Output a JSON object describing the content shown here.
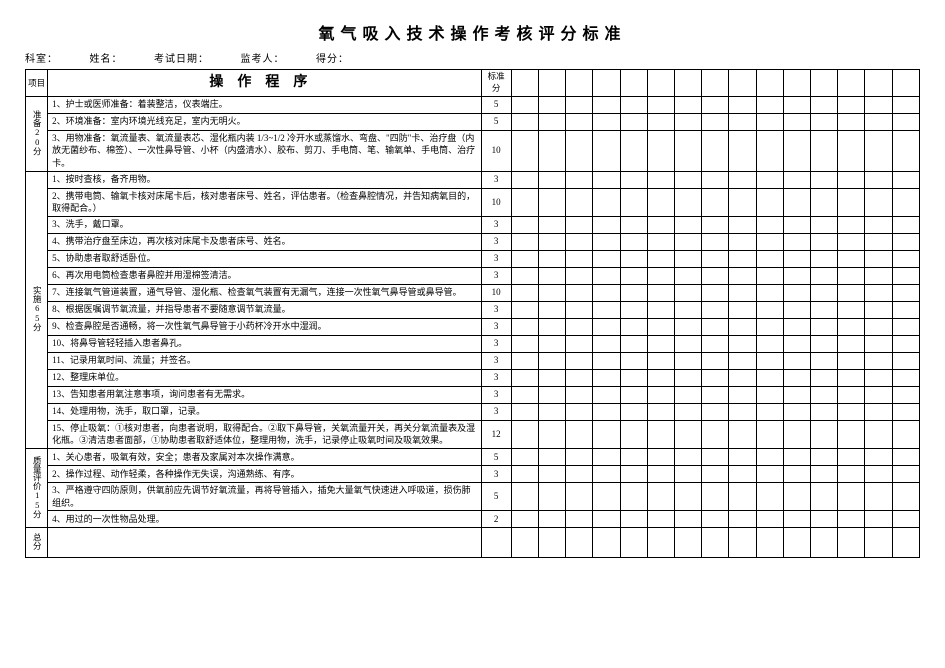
{
  "title": "氧气吸入技术操作考核评分标准",
  "header": {
    "dept_label": "科室：",
    "name_label": "姓名：",
    "date_label": "考试日期：",
    "examiner_label": "监考人：",
    "score_label": "得分："
  },
  "thead": {
    "cat": "项目",
    "proc": "操作程序",
    "stdscore": "标准分"
  },
  "sections": [
    {
      "cat_label": "准备20分",
      "rows": [
        {
          "text": "1、护士或医师准备：着装整洁，仪表端庄。",
          "score": "5"
        },
        {
          "text": "2、环境准备：室内环境光线充足，室内无明火。",
          "score": "5"
        },
        {
          "text": "3、用物准备：氧流量表、氧流量表芯、湿化瓶内装 1/3~1/2 冷开水或蒸馏水、弯盘、\"四防\"卡、治疗盘（内放无菌纱布、棉签）、一次性鼻导管、小杯（内盛清水）、胶布、剪刀、手电筒、笔、输氧单、手电筒、治疗卡。",
          "score": "10"
        }
      ]
    },
    {
      "cat_label": "实施65分",
      "rows": [
        {
          "text": "1、按时查核，备齐用物。",
          "score": "3"
        },
        {
          "text": "2、携带电筒、输氧卡核对床尾卡后，核对患者床号、姓名，评估患者。（检查鼻腔情况，并告知病氧目的，取得配合。）",
          "score": "10"
        },
        {
          "text": "3、洗手，戴口罩。",
          "score": "3"
        },
        {
          "text": "4、携带治疗盘至床边，再次核对床尾卡及患者床号、姓名。",
          "score": "3"
        },
        {
          "text": "5、协助患者取舒适卧位。",
          "score": "3"
        },
        {
          "text": "6、再次用电筒检查患者鼻腔并用湿棉签清洁。",
          "score": "3"
        },
        {
          "text": "7、连接氧气管道装置，通气导管、湿化瓶、检查氧气装置有无漏气，连接一次性氧气鼻导管或鼻导管。",
          "score": "10"
        },
        {
          "text": "8、根据医嘱调节氧流量，并指导患者不要随意调节氧流量。",
          "score": "3"
        },
        {
          "text": "9、检查鼻腔是否通畅，将一次性氧气鼻导管于小药杯冷开水中湿润。",
          "score": "3"
        },
        {
          "text": "10、将鼻导管轻轻插入患者鼻孔。",
          "score": "3"
        },
        {
          "text": "11、记录用氧时间、流量；并签名。",
          "score": "3"
        },
        {
          "text": "12、整理床单位。",
          "score": "3"
        },
        {
          "text": "13、告知患者用氧注意事项，询问患者有无需求。",
          "score": "3"
        },
        {
          "text": "14、处理用物，洗手，取口罩，记录。",
          "score": "3"
        },
        {
          "text": "15、停止吸氧：①核对患者，向患者说明，取得配合。②取下鼻导管，关氧流量开关，再关分氧流量表及湿化瓶。③清洁患者面部，①协助患者取舒适体位，整理用物，洗手，记录停止吸氧时间及吸氧效果。",
          "score": "12"
        }
      ]
    },
    {
      "cat_label": "质量评价15分",
      "rows": [
        {
          "text": "1、关心患者，吸氧有效，安全；患者及家属对本次操作满意。",
          "score": "5"
        },
        {
          "text": "2、操作过程、动作轻柔，各种操作无失误，沟通熟练、有序。",
          "score": "3"
        },
        {
          "text": "3、严格遵守四防原则，供氧前应先调节好氧流量，再将导管插入，插免大量氧气快速进入呼吸道，损伤肺组织。",
          "score": "5"
        },
        {
          "text": "4、用过的一次性物品处理。",
          "score": "2"
        }
      ]
    }
  ],
  "total_label": "总分"
}
